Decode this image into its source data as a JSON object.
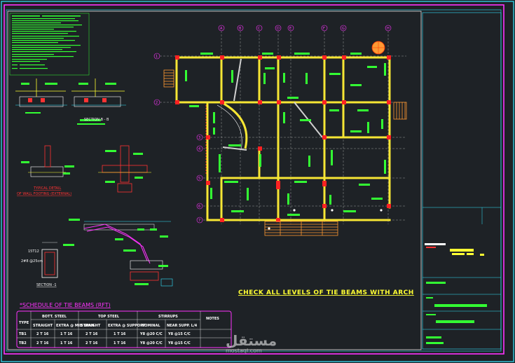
{
  "drawing": {
    "note_block": {
      "lines": [
        "",
        "",
        "",
        "",
        "",
        "",
        "",
        "",
        "",
        "",
        "",
        "",
        "",
        "",
        "",
        ""
      ]
    },
    "detail_labels": {
      "section_b": "SECTION B - B",
      "typical_detail": "TYPICAL DETAIL",
      "wall_footing": "OF WALL FOOTING (EXTERNAL)",
      "section_1": "SECTION -1",
      "dim_1": "15T12",
      "dim_2": "2#8 @25cm"
    },
    "plan_note": "CHECK ALL LEVELS OF TIE BEAMS WITH ARCH",
    "grid_labels_top": [
      "A",
      "B",
      "C",
      "D",
      "E",
      "F",
      "G",
      "H"
    ],
    "grid_labels_left": [
      "1",
      "2",
      "3",
      "4",
      "5",
      "6",
      "7"
    ]
  },
  "schedule": {
    "title": "*SCHEDULE OF TIE BEAMS (RFT)",
    "headers": {
      "type": "TYPE",
      "bott_steel": "BOTT. STEEL",
      "straight": "STRAIGHT",
      "extra_mid": "EXTRA @ MID SPAN",
      "top_steel": "TOP STEEL",
      "straight_top": "STRAIGHT",
      "extra_support": "EXTRA @ SUPPORT",
      "stirrups": "STIRRUPS",
      "nominal": "NOMINAL",
      "near_supp": "NEAR SUPP. L/4",
      "notes": "NOTES"
    },
    "rows": [
      {
        "type": "TB1",
        "bott_straight": "2 T 16",
        "bott_extra": "1 T 16",
        "top_straight": "2 T 16",
        "top_extra": "1 T 16",
        "nominal": "Y8 @20 C/C",
        "near": "Y8 @15 C/C",
        "notes": ""
      },
      {
        "type": "TB2",
        "bott_straight": "2 T 16",
        "bott_extra": "1 T 16",
        "top_straight": "2 T 16",
        "top_extra": "1 T 16",
        "nominal": "Y8 @20 C/C",
        "near": "Y8 @15 C/C",
        "notes": ""
      }
    ]
  },
  "watermark": {
    "arabic": "مستقل",
    "latin": "mostaql.com"
  },
  "colors": {
    "background": "#1e2226",
    "border_cyan": "#33e6ff",
    "border_magenta": "#ff33ff",
    "beam_yellow": "#f7e634",
    "column_red": "#ff2222",
    "rebar_green": "#33ff33",
    "stair_orange": "#ff9933"
  }
}
